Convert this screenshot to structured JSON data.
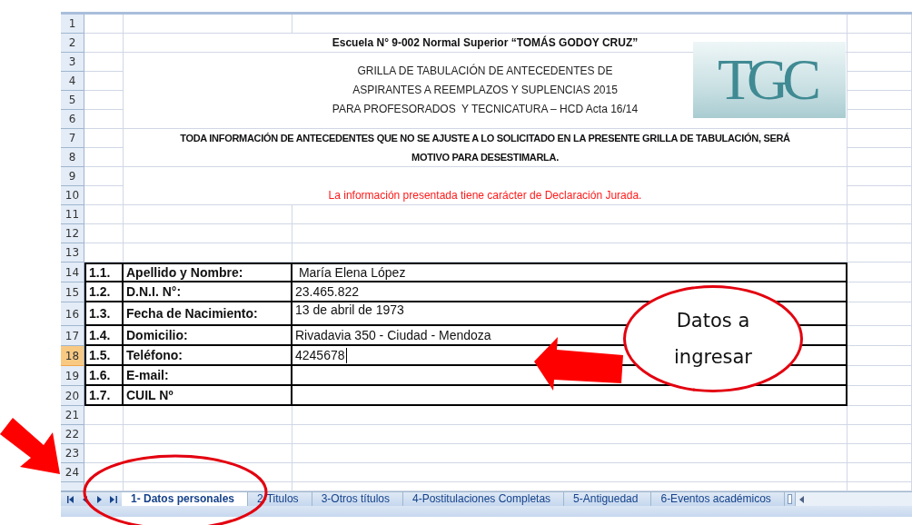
{
  "row_numbers": [
    {
      "label": "1",
      "selected": false
    },
    {
      "label": "2",
      "selected": false
    },
    {
      "label": "3",
      "selected": false
    },
    {
      "label": "4",
      "selected": false
    },
    {
      "label": "5",
      "selected": false
    },
    {
      "label": "6",
      "selected": false
    },
    {
      "label": "7",
      "selected": false
    },
    {
      "label": "8",
      "selected": false
    },
    {
      "label": "9",
      "selected": false
    },
    {
      "label": "10",
      "selected": false
    },
    {
      "label": "11",
      "selected": false
    },
    {
      "label": "12",
      "selected": false
    },
    {
      "label": "13",
      "selected": false
    },
    {
      "label": "14",
      "selected": false
    },
    {
      "label": "15",
      "selected": false
    },
    {
      "label": "16",
      "selected": false
    },
    {
      "label": "17",
      "selected": false
    },
    {
      "label": "18",
      "selected": true
    },
    {
      "label": "19",
      "selected": false
    },
    {
      "label": "20",
      "selected": false
    },
    {
      "label": "21",
      "selected": false
    },
    {
      "label": "22",
      "selected": false
    },
    {
      "label": "23",
      "selected": false
    },
    {
      "label": "24",
      "selected": false
    }
  ],
  "header": {
    "school": "Escuela N° 9-002 Normal Superior “TOMÁS GODOY CRUZ”",
    "subtitle_lines": [
      "GRILLA DE TABULACIÓN DE ANTECEDENTES DE",
      "ASPIRANTES A REEMPLAZOS Y SUPLENCIAS 2015",
      "PARA PROFESORADOS  Y TECNICATURA – HCD Acta 16/14"
    ],
    "warning_lines": [
      "TODA INFORMACIÓN DE ANTECEDENTES QUE NO SE AJUSTE A LO SOLICITADO EN LA PRESENTE GRILLA DE TABULACIÓN, SERÁ",
      "MOTIVO PARA DESESTIMARLA."
    ],
    "declaration": "La información presentada tiene carácter de Declaración Jurada."
  },
  "logo": {
    "text": "TGC"
  },
  "form_rows": [
    {
      "number": "1.1.",
      "label": "Apellido y Nombre:",
      "value": " María Elena López",
      "editing": false
    },
    {
      "number": "1.2.",
      "label": "D.N.I. N°:",
      "value": "23.465.822",
      "editing": false
    },
    {
      "number": "1.3.",
      "label": "Fecha de Nacimiento:",
      "value": "13 de abril de 1973",
      "editing": false
    },
    {
      "number": "1.4.",
      "label": "Domicilio:",
      "value": "Rivadavia 350 - Ciudad - Mendoza",
      "editing": false
    },
    {
      "number": "1.5.",
      "label": "Teléfono:",
      "value": "4245678",
      "editing": true
    },
    {
      "number": "1.6.",
      "label": "E-mail:",
      "editing": false
    },
    {
      "number": "1.7.",
      "label": "CUIL Nº",
      "editing": false
    }
  ],
  "sheet_tabs": [
    {
      "label": "1- Datos personales",
      "selected": true
    },
    {
      "label": "2-Titulos",
      "selected": false
    },
    {
      "label": "3-Otros títulos",
      "selected": false
    },
    {
      "label": "4-Postitulaciones Completas",
      "selected": false
    },
    {
      "label": "5-Antiguedad",
      "selected": false
    },
    {
      "label": "6-Eventos académicos",
      "selected": false
    }
  ],
  "callout": {
    "lines": [
      "Datos a",
      "ingresar"
    ]
  }
}
